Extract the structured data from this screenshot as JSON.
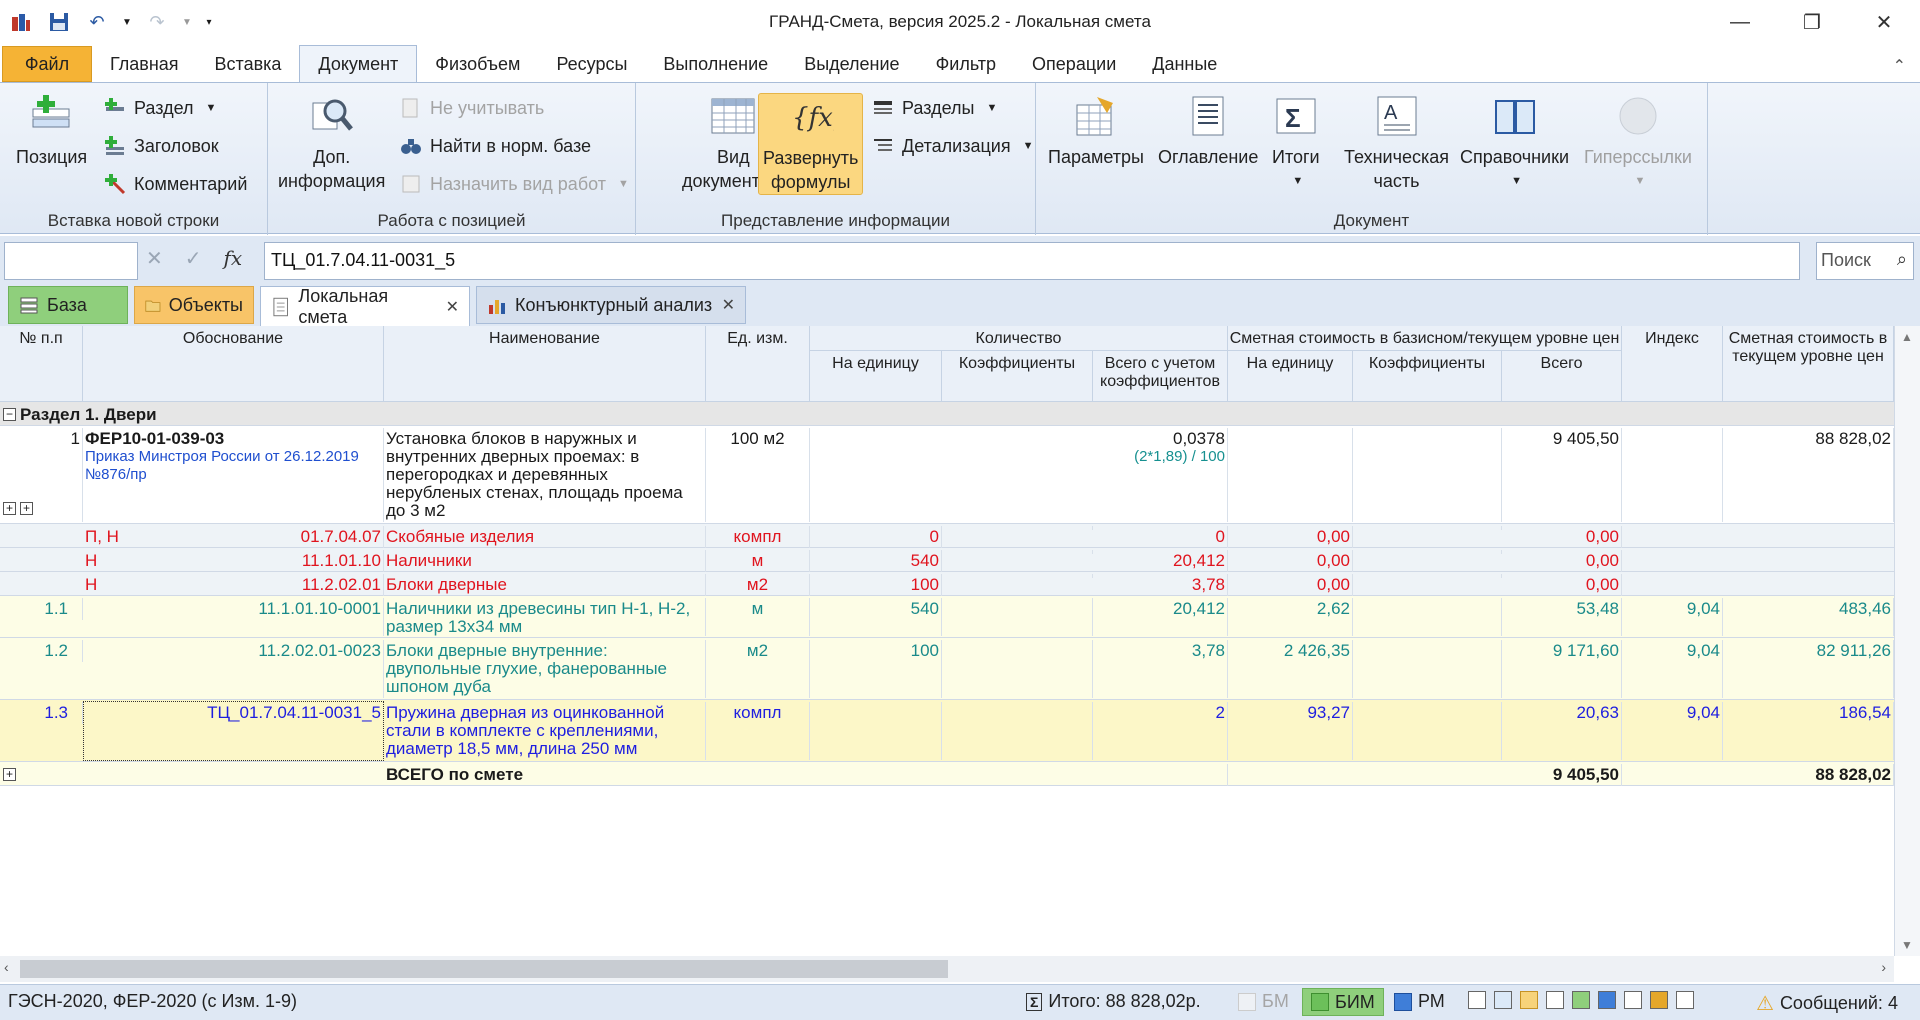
{
  "window": {
    "title": "ГРАНД-Смета, версия 2025.2 - Локальная смета",
    "minimize": "—",
    "maximize": "❐",
    "close": "✕"
  },
  "ribbon_tabs": [
    "Файл",
    "Главная",
    "Вставка",
    "Документ",
    "Физобъем",
    "Ресурсы",
    "Выполнение",
    "Выделение",
    "Фильтр",
    "Операции",
    "Данные"
  ],
  "ribbon": {
    "insert_group": {
      "label": "Вставка новой строки",
      "position": "Позиция",
      "section": "Раздел",
      "header": "Заголовок",
      "comment": "Комментарий"
    },
    "position_group": {
      "label": "Работа с позицией",
      "extra_info_1": "Доп.",
      "extra_info_2": "информация",
      "ignore": "Не учитывать",
      "find_norm": "Найти в норм. базе",
      "assign_work": "Назначить вид работ"
    },
    "view_group": {
      "label": "Представление информации",
      "doc_view_1": "Вид",
      "doc_view_2": "документа",
      "expand_1": "Развернуть",
      "expand_2": "формулы",
      "sections": "Разделы",
      "detail": "Детализация"
    },
    "document_group": {
      "label": "Документ",
      "params": "Параметры",
      "toc": "Оглавление",
      "totals": "Итоги",
      "tech_1": "Техническая",
      "tech_2": "часть",
      "refs": "Справочники",
      "links": "Гиперссылки"
    }
  },
  "formula_bar": {
    "value": "ТЦ_01.7.04.11-0031_5",
    "search_placeholder": "Поиск"
  },
  "doc_tabs": {
    "base": "База",
    "objects": "Объекты",
    "local": "Локальная смета",
    "konj": "Конъюнктурный анализ"
  },
  "columns": {
    "num": "№ п.п",
    "basis": "Обоснование",
    "name": "Наименование",
    "unit": "Ед. изм.",
    "qty_group": "Количество",
    "qty_unit": "На единицу",
    "qty_coef": "Коэффициенты",
    "qty_total": "Всего с учетом коэффициентов",
    "cost_group": "Сметная стоимость в базисном/текущем уровне цен",
    "cost_unit": "На единицу",
    "cost_coef": "Коэффициенты",
    "cost_total": "Всего",
    "index": "Индекс",
    "current": "Сметная стоимость в текущем уровне цен"
  },
  "section_title": "Раздел 1. Двери",
  "row1": {
    "num": "1",
    "code": "ФЕР10-01-039-03",
    "order": "Приказ Минстроя России от 26.12.2019 №876/пр",
    "name": "Установка блоков в наружных и внутренних дверных проемах: в перегородках и деревянных нерубленых стенах, площадь проема до 3 м2",
    "unit": "100 м2",
    "qty_total": "0,0378",
    "formula": "(2*1,89) / 100",
    "cost_total": "9 405,50",
    "current": "88 828,02"
  },
  "res_rows": [
    {
      "type": "П, Н",
      "code": "01.7.04.07",
      "name": "Скобяные изделия",
      "unit": "компл",
      "qty_unit": "0",
      "qty_total": "0",
      "cost_unit": "0,00",
      "cost_total": "0,00"
    },
    {
      "type": "Н",
      "code": "11.1.01.10",
      "name": "Наличники",
      "unit": "м",
      "qty_unit": "540",
      "qty_total": "20,412",
      "cost_unit": "0,00",
      "cost_total": "0,00"
    },
    {
      "type": "Н",
      "code": "11.2.02.01",
      "name": "Блоки дверные",
      "unit": "м2",
      "qty_unit": "100",
      "qty_total": "3,78",
      "cost_unit": "0,00",
      "cost_total": "0,00"
    }
  ],
  "sub_rows": [
    {
      "num": "1.1",
      "code": "11.1.01.10-0001",
      "name": "Наличники из древесины тип Н-1, Н-2, размер 13х34 мм",
      "unit": "м",
      "qty_unit": "540",
      "qty_total": "20,412",
      "cost_unit": "2,62",
      "cost_total": "53,48",
      "index": "9,04",
      "current": "483,46"
    },
    {
      "num": "1.2",
      "code": "11.2.02.01-0023",
      "name": "Блоки дверные внутренние: двупольные глухие, фанерованные шпоном дуба",
      "unit": "м2",
      "qty_unit": "100",
      "qty_total": "3,78",
      "cost_unit": "2 426,35",
      "cost_total": "9 171,60",
      "index": "9,04",
      "current": "82 911,26"
    },
    {
      "num": "1.3",
      "code": "ТЦ_01.7.04.11-0031_5",
      "name": "Пружина дверная из оцинкованной стали в комплекте с креплениями, диаметр 18,5 мм, длина 250 мм",
      "unit": "компл",
      "qty_unit": "",
      "qty_total": "2",
      "cost_unit": "93,27",
      "cost_total": "20,63",
      "index": "9,04",
      "current": "186,54"
    }
  ],
  "total_row": {
    "label": "ВСЕГО по смете",
    "cost_total": "9 405,50",
    "current": "88 828,02"
  },
  "status": {
    "base": "ГЭСН-2020, ФЕР-2020 (с Изм. 1-9)",
    "total": "Итого: 88 828,02р.",
    "bm": "БМ",
    "bim": "БИМ",
    "rm": "РМ",
    "messages": "Сообщений: 4"
  }
}
